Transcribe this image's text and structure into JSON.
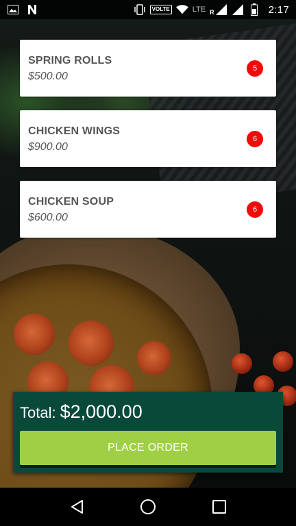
{
  "status_bar": {
    "clock": "2:17",
    "volte_label": "VOLTE",
    "lte_label": "LTE",
    "roaming_label": "R",
    "icons": [
      "image-icon",
      "n-notification-icon",
      "vibrate-icon",
      "wifi-icon",
      "signal-icon",
      "battery-icon"
    ]
  },
  "order": {
    "items": [
      {
        "name": "SPRING ROLLS",
        "price": "$500.00",
        "quantity": "5"
      },
      {
        "name": "CHICKEN WINGS",
        "price": "$900.00",
        "quantity": "6"
      },
      {
        "name": "CHICKEN SOUP",
        "price": "$600.00",
        "quantity": "6"
      }
    ]
  },
  "summary": {
    "total_label": "Total:",
    "total_value": "$2,000.00",
    "place_order_label": "PLACE ORDER"
  },
  "nav_bar": {
    "buttons": [
      "back-icon",
      "home-icon",
      "recents-icon"
    ]
  },
  "colors": {
    "card_bg": "#ffffff",
    "item_text": "#555555",
    "badge": "#f20a0a",
    "total_panel": "#08493a",
    "place_order_button": "#9fcf45"
  }
}
